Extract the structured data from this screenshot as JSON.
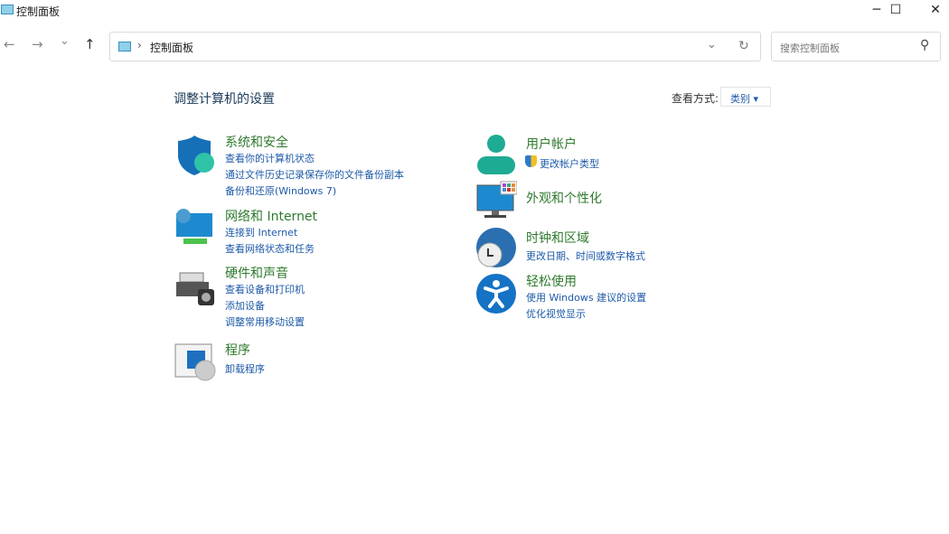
{
  "window": {
    "title": "控制面板",
    "minimize": "─",
    "maximize": "☐",
    "close": "✕"
  },
  "nav": {
    "back": "←",
    "forward": "→",
    "recent": "⌄",
    "up": "↑"
  },
  "address": {
    "separator": "›",
    "path": "控制面板",
    "dropdown": "⌄",
    "refresh": "↻"
  },
  "search": {
    "placeholder": "搜索控制面板",
    "icon": "⚲"
  },
  "main": {
    "heading": "调整计算机的设置",
    "view_by_label": "查看方式:",
    "view_by_value": "类别",
    "view_by_arrow": "▾",
    "left": [
      {
        "title": "系统和安全",
        "icon": "shield-icon",
        "links": [
          "查看你的计算机状态",
          "通过文件历史记录保存你的文件备份副本",
          "备份和还原(Windows 7)"
        ]
      },
      {
        "title": "网络和 Internet",
        "icon": "network-icon",
        "links": [
          "连接到 Internet",
          "查看网络状态和任务"
        ]
      },
      {
        "title": "硬件和声音",
        "icon": "printer-icon",
        "links": [
          "查看设备和打印机",
          "添加设备",
          "调整常用移动设置"
        ]
      },
      {
        "title": "程序",
        "icon": "programs-icon",
        "links": [
          "卸载程序"
        ]
      }
    ],
    "right": [
      {
        "title": "用户帐户",
        "icon": "user-icon",
        "links": [
          "更改帐户类型"
        ]
      },
      {
        "title": "外观和个性化",
        "icon": "monitor-icon",
        "links": []
      },
      {
        "title": "时钟和区域",
        "icon": "clock-globe-icon",
        "links": [
          "更改日期、时间或数字格式"
        ]
      },
      {
        "title": "轻松使用",
        "icon": "accessibility-icon",
        "links": [
          "使用 Windows 建议的设置",
          "优化视觉显示"
        ]
      }
    ]
  }
}
